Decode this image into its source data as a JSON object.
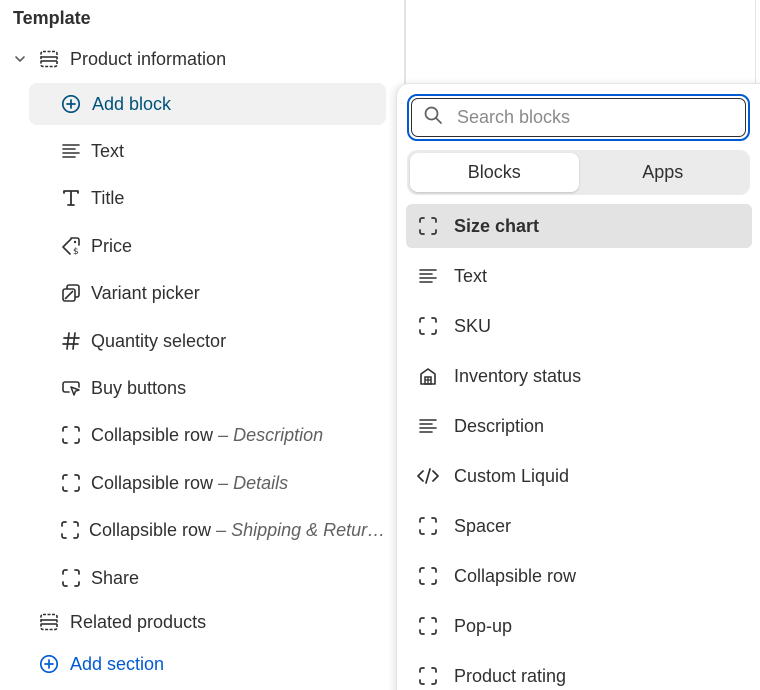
{
  "sidebar": {
    "title": "Template",
    "section": "Product information",
    "add_block": "Add block",
    "blocks": [
      {
        "label": "Text",
        "sub": ""
      },
      {
        "label": "Title",
        "sub": ""
      },
      {
        "label": "Price",
        "sub": ""
      },
      {
        "label": "Variant picker",
        "sub": ""
      },
      {
        "label": "Quantity selector",
        "sub": ""
      },
      {
        "label": "Buy buttons",
        "sub": ""
      },
      {
        "label": "Collapsible row",
        "sub": "– Description"
      },
      {
        "label": "Collapsible row",
        "sub": "– Details"
      },
      {
        "label": "Collapsible row",
        "sub": "– Shipping & Retur…"
      },
      {
        "label": "Share",
        "sub": ""
      }
    ],
    "related": "Related products",
    "add_section": "Add section"
  },
  "popover": {
    "search_placeholder": "Search blocks",
    "tabs": [
      "Blocks",
      "Apps"
    ],
    "items": [
      {
        "label": "Size chart",
        "icon": "dashed-square-icon"
      },
      {
        "label": "Text",
        "icon": "text-lines-icon"
      },
      {
        "label": "SKU",
        "icon": "dashed-square-icon"
      },
      {
        "label": "Inventory status",
        "icon": "store-icon"
      },
      {
        "label": "Description",
        "icon": "text-lines-icon"
      },
      {
        "label": "Custom Liquid",
        "icon": "code-icon"
      },
      {
        "label": "Spacer",
        "icon": "dashed-square-icon"
      },
      {
        "label": "Collapsible row",
        "icon": "dashed-square-icon"
      },
      {
        "label": "Pop-up",
        "icon": "dashed-square-icon"
      },
      {
        "label": "Product rating",
        "icon": "dashed-square-icon"
      }
    ]
  },
  "colors": {
    "accent": "#005bd3",
    "add_block_text": "#00527c"
  }
}
